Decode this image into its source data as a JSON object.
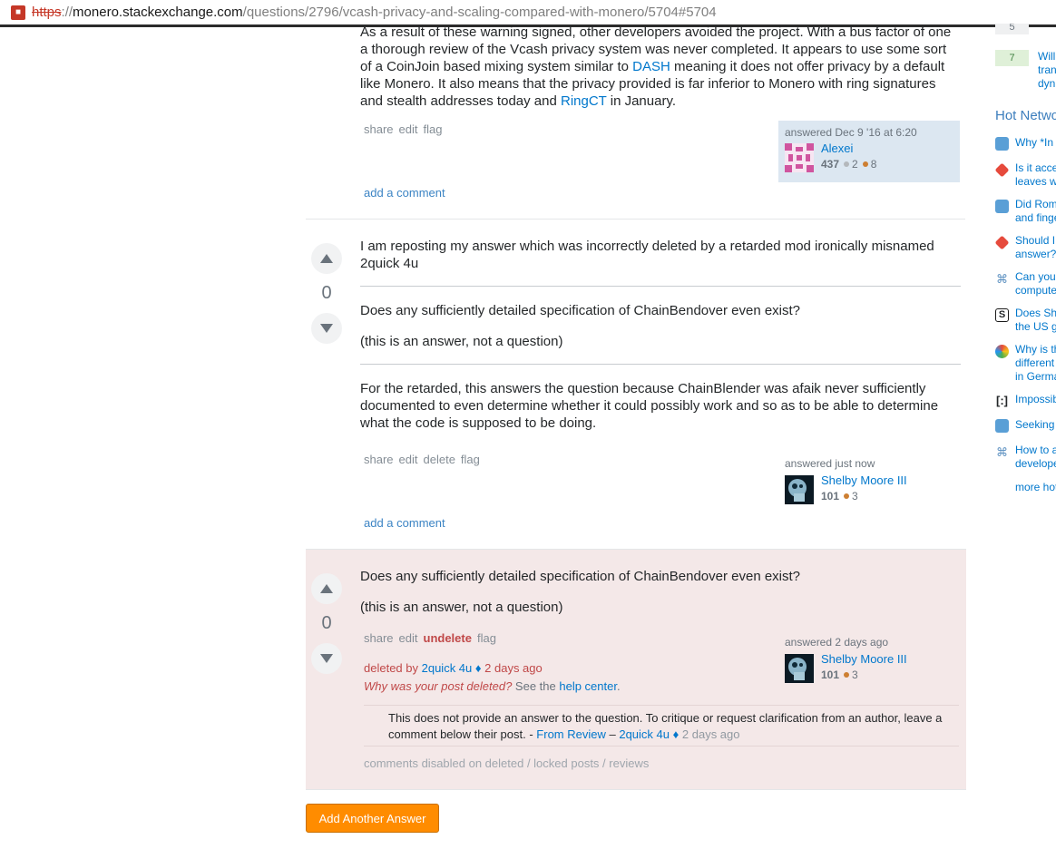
{
  "browser": {
    "url_scheme": "https",
    "url_sep": "://",
    "url_host": "monero.stackexchange.com",
    "url_path": "/questions/2796/vcash-privacy-and-scaling-compared-with-monero/5704#5704"
  },
  "answer1": {
    "text_partial_top": "As a result of these warning signed, other developers avoided the project. With a bus factor of one",
    "text_line2": "a thorough review of the Vcash privacy system was never completed. It appears to use some sort",
    "text_line3a": "of a CoinJoin based mixing system similar to ",
    "link_dash": "DASH",
    "text_line3b": " meaning it does not offer privacy by a default",
    "text_line4": "like Monero. It also means that the privacy provided is far inferior to Monero with ring signatures",
    "text_line5a": "and stealth addresses today and ",
    "link_ringct": "RingCT",
    "text_line5b": " in January.",
    "menu": [
      "share",
      "edit",
      "flag"
    ],
    "answered_label": "answered Dec 9 '16 at 6:20",
    "user_name": "Alexei",
    "user_rep": "437",
    "silver_badges": "2",
    "bronze_badges": "8",
    "add_comment": "add a comment"
  },
  "answer2": {
    "vote_count": "0",
    "para1": "I am reposting my answer which was incorrectly deleted by a retarded mod ironically misnamed 2quick 4u",
    "para2": "Does any sufficiently detailed specification of ChainBendover even exist?",
    "para3": "(this is an answer, not a question)",
    "para4": "For the retarded, this answers the question because ChainBlender was afaik never sufficiently documented to even determine whether it could possibly work and so as to be able to determine what the code is supposed to be doing.",
    "menu": [
      "share",
      "edit",
      "delete",
      "flag"
    ],
    "answered_label": "answered just now",
    "user_name": "Shelby Moore III",
    "user_rep": "101",
    "bronze_badges": "3",
    "add_comment": "add a comment"
  },
  "answer3": {
    "vote_count": "0",
    "para1": "Does any sufficiently detailed specification of ChainBendover even exist?",
    "para2": "(this is an answer, not a question)",
    "menu_share": "share",
    "menu_edit": "edit",
    "menu_undelete": "undelete",
    "menu_flag": "flag",
    "deleted_by_prefix": "deleted by ",
    "deleted_by_user": "2quick 4u",
    "mod_diamond": "♦",
    "deleted_time": " 2 days ago",
    "why_deleted": "Why was your post deleted?",
    "see_the": " See the ",
    "help_center": "help center",
    "period": ".",
    "answered_label": "answered 2 days ago",
    "user_name": "Shelby Moore III",
    "user_rep": "101",
    "bronze_badges": "3",
    "review_comment": "This does not provide an answer to the question. To critique or request clarification from an author, leave a comment below their post. - ",
    "from_review": "From Review",
    "dash": " – ",
    "comment_user": "2quick 4u",
    "comment_time": "2 days ago",
    "comments_disabled": "comments disabled on deleted / locked posts / reviews"
  },
  "add_another_answer": "Add Another Answer",
  "sidebar": {
    "linked_count_top": "5",
    "linked_count": "7",
    "linked_text": [
      "Will",
      "tran",
      "dyn"
    ],
    "hot_network_title": "Hot Network",
    "hot_items": [
      [
        "Why *In"
      ],
      [
        "Is it acce",
        "leaves w"
      ],
      [
        "Did Rom",
        "and finge"
      ],
      [
        "Should I",
        "answer?"
      ],
      [
        "Can you",
        "compute"
      ],
      [
        "Does Sh",
        "the US g"
      ],
      [
        "Why is th",
        "different",
        "in Germa"
      ],
      [
        "Impossib"
      ],
      [
        "Seeking"
      ],
      [
        "How to a",
        "develope"
      ]
    ],
    "more_hot": "more hot"
  },
  "colors": {
    "link": "#0077cc",
    "deleted_bg": "#f4e8e8",
    "owner_bg": "#e1ecf4",
    "button": "#ff8c00"
  }
}
